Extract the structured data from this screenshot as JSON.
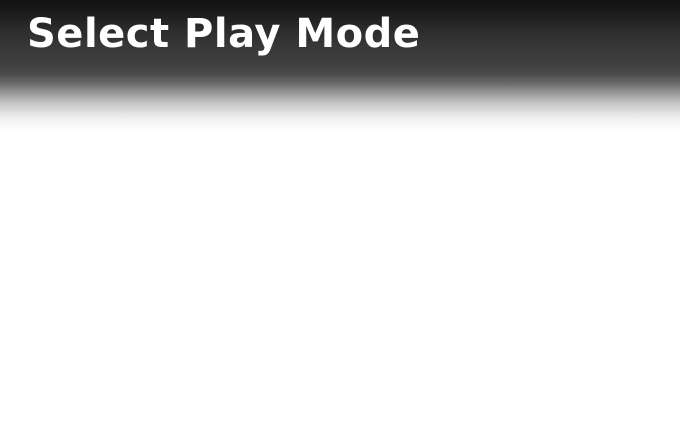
{
  "screen": {
    "title": "Select Play Mode"
  },
  "colors": {
    "header_dark": "#111111",
    "header_mid": "#3f3f3f",
    "background": "#ffffff",
    "title_text": "#ffffff"
  }
}
